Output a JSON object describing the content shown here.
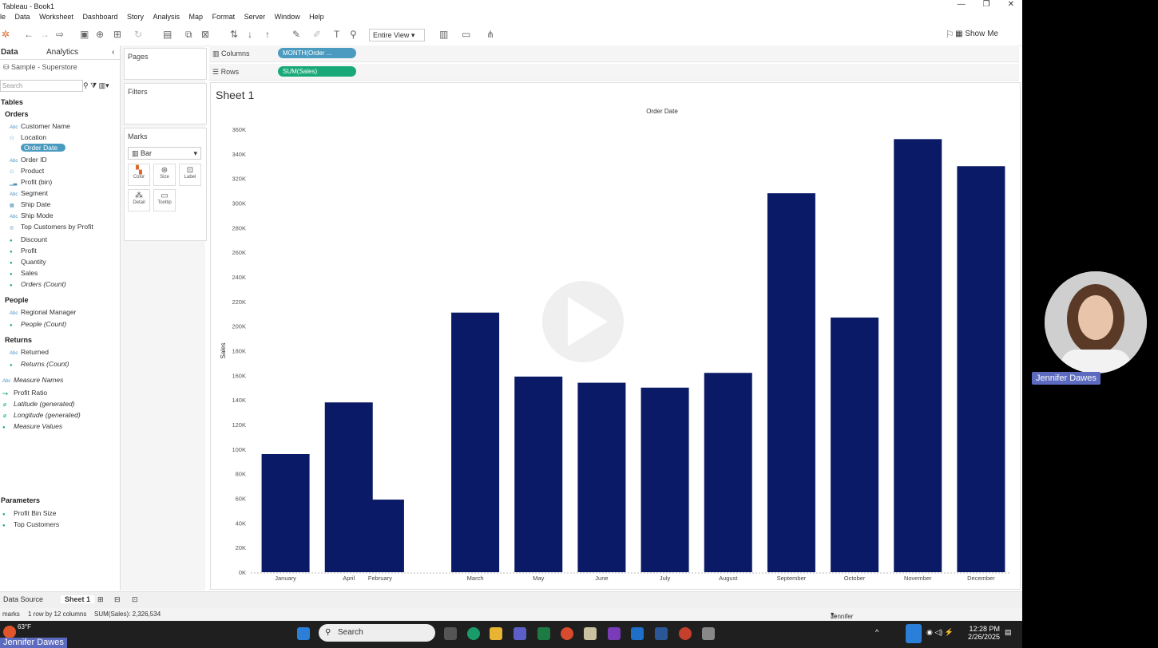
{
  "window": {
    "title": "Tableau - Book1"
  },
  "menu": [
    "le",
    "Data",
    "Worksheet",
    "Dashboard",
    "Story",
    "Analysis",
    "Map",
    "Format",
    "Server",
    "Window",
    "Help"
  ],
  "toolbar": {
    "fit": "Entire View",
    "show_me": "Show Me"
  },
  "data_pane": {
    "tab_data": "Data",
    "tab_analytics": "Analytics",
    "source": "Sample - Superstore",
    "search_placeholder": "Search",
    "tables_label": "Tables",
    "orders_label": "Orders",
    "orders_fields": [
      "Customer Name",
      "Location",
      "Order Date",
      "Order ID",
      "Product",
      "Profit (bin)",
      "Segment",
      "Ship Date",
      "Ship Mode",
      "Top Customers by Profit"
    ],
    "orders_measures": [
      "Discount",
      "Profit",
      "Quantity",
      "Sales",
      "Orders (Count)"
    ],
    "people_label": "People",
    "people_fields": [
      "Regional Manager",
      "People (Count)"
    ],
    "returns_label": "Returns",
    "returns_fields": [
      "Returned",
      "Returns (Count)"
    ],
    "extra_fields": [
      "Measure Names",
      "Profit Ratio",
      "Latitude (generated)",
      "Longitude (generated)",
      "Measure Values"
    ],
    "parameters_label": "Parameters",
    "parameters": [
      "Profit Bin Size",
      "Top Customers"
    ]
  },
  "cards": {
    "pages": "Pages",
    "filters": "Filters",
    "marks": "Marks",
    "mark_type": "Bar",
    "mark_buttons": [
      "Color",
      "Size",
      "Label",
      "Detail",
      "Tooltip"
    ]
  },
  "shelves": {
    "columns_label": "Columns",
    "columns_pill": "MONTH(Order ...",
    "rows_label": "Rows",
    "rows_pill": "SUM(Sales)"
  },
  "colors": {
    "bar": "#0a1a66",
    "dim_pill": "#4a9bbf",
    "meas_pill": "#19a979",
    "accent": "#5c6bc0"
  },
  "sheet": {
    "title": "Sheet 1"
  },
  "chart_data": {
    "type": "bar",
    "title": "Order Date",
    "xlabel": "",
    "ylabel": "Sales",
    "ylim": [
      0,
      360000
    ],
    "yticks": [
      "0K",
      "20K",
      "40K",
      "60K",
      "80K",
      "100K",
      "120K",
      "140K",
      "160K",
      "180K",
      "200K",
      "220K",
      "240K",
      "260K",
      "280K",
      "300K",
      "320K",
      "340K",
      "360K"
    ],
    "categories": [
      "January",
      "April",
      "February",
      "March",
      "May",
      "June",
      "July",
      "August",
      "September",
      "October",
      "November",
      "December"
    ],
    "values": [
      96000,
      138000,
      59000,
      211000,
      159000,
      154000,
      150000,
      162000,
      308000,
      207000,
      352000,
      330000
    ],
    "grid": false,
    "legend": "none"
  },
  "bottom": {
    "data_source": "Data Source",
    "sheet_tab": "Sheet 1"
  },
  "status": {
    "marks": "marks",
    "dims": "1 row by 12 columns",
    "sum": "SUM(Sales): 2,326,534",
    "user": "Jennifer Dawes"
  },
  "taskbar": {
    "search": "Search",
    "temp": "63°F",
    "time": "12:28 PM",
    "date": "2/26/2025"
  },
  "presenter": {
    "name": "Jennifer Dawes",
    "tag": "Jennifer Dawes"
  }
}
